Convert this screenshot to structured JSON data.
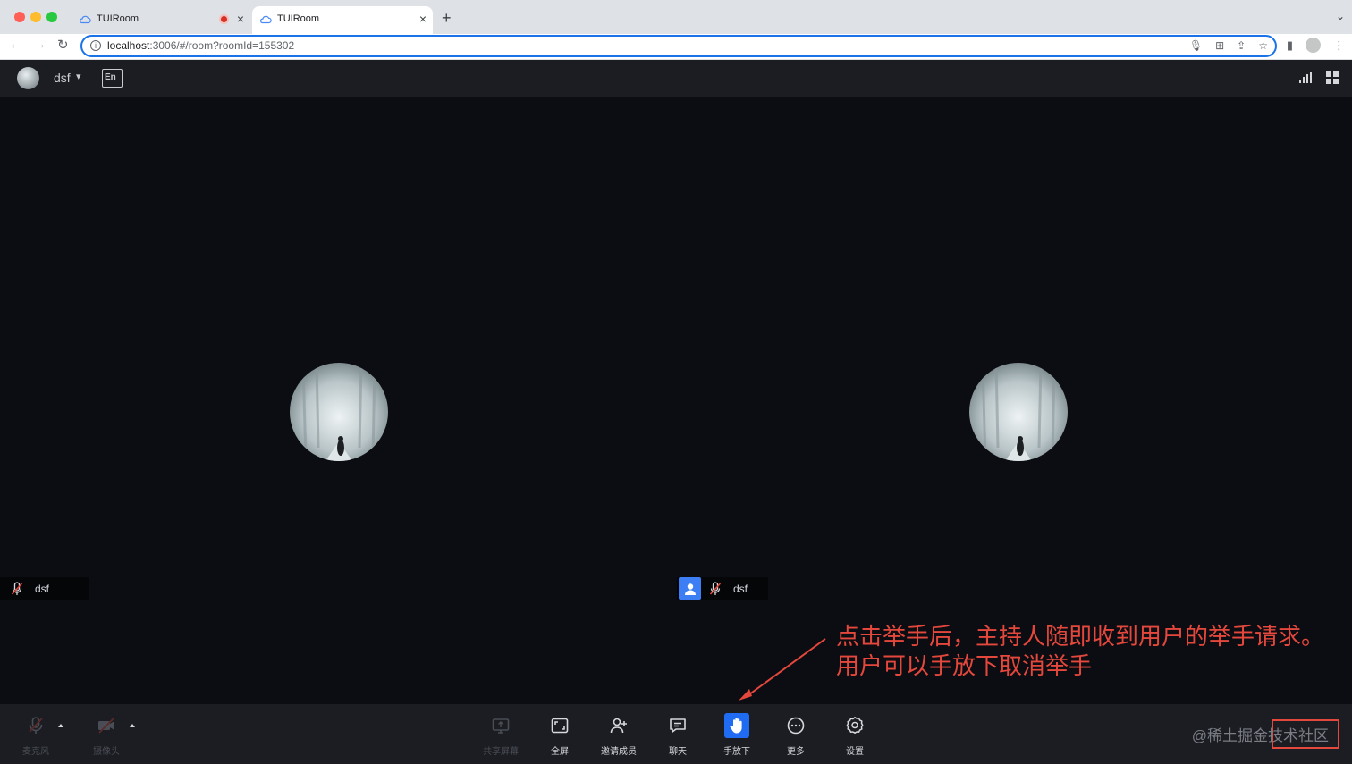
{
  "browser": {
    "tabs": [
      {
        "title": "TUIRoom",
        "recording": true
      },
      {
        "title": "TUIRoom",
        "active": true
      }
    ],
    "url_host": "localhost",
    "url_path": ":3006/#/room?roomId=155302"
  },
  "header": {
    "user_name": "dsf",
    "lang_button": "En"
  },
  "stage": {
    "left_tile_name": "dsf",
    "right_tile_name": "dsf"
  },
  "annotation": {
    "line1": "点击举手后，主持人随即收到用户的举手请求。",
    "line2": "用户可以手放下取消举手"
  },
  "bottombar": {
    "mic_label": "麦克风",
    "camera_label": "摄像头",
    "share_label": "共享屏幕",
    "fullscreen_label": "全屏",
    "invite_label": "邀请成员",
    "chat_label": "聊天",
    "hand_label": "手放下",
    "more_label": "更多",
    "settings_label": "设置",
    "watermark": "@稀土掘金技术社区"
  },
  "colors": {
    "accent": "#1f6cf3",
    "annotation": "#e4473b",
    "background": "#0b0d13"
  }
}
